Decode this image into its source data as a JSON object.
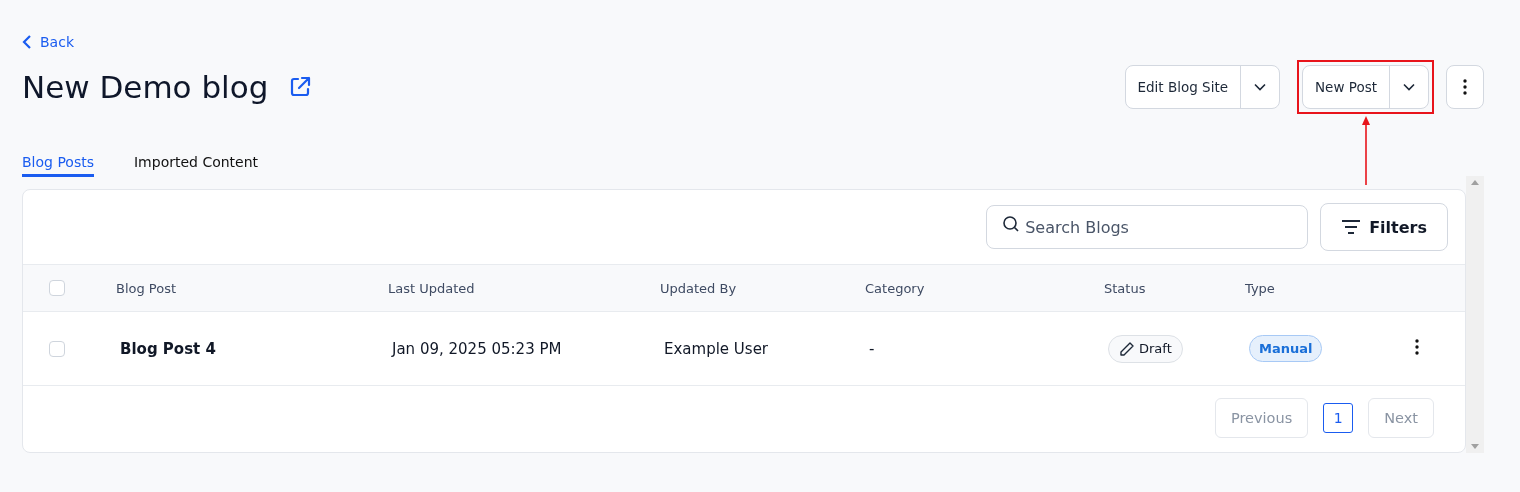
{
  "back": {
    "label": "Back"
  },
  "title": "New Demo blog",
  "actions": [
    {
      "label": "Edit Blog Site",
      "highlighted": false
    },
    {
      "label": "New Post",
      "highlighted": true
    }
  ],
  "tabs": [
    {
      "label": "Blog Posts",
      "selected": true
    },
    {
      "label": "Imported Content",
      "selected": false
    }
  ],
  "search": {
    "placeholder": "Search Blogs"
  },
  "filters": {
    "label": "Filters"
  },
  "table": {
    "select_all": {
      "checked": false
    },
    "columns": [
      "Blog Post",
      "Last Updated",
      "Updated By",
      "Category",
      "Status",
      "Type"
    ],
    "rows": [
      {
        "checked": false,
        "title": "Blog Post 4",
        "last_updated": "Jan 09, 2025 05:23 PM",
        "updated_by": "Example User",
        "category": "-",
        "status": "Draft",
        "type": "Manual"
      }
    ]
  },
  "pagination": {
    "previous": "Previous",
    "next": "Next",
    "pages": [
      {
        "label": "1",
        "selected": true
      }
    ]
  }
}
